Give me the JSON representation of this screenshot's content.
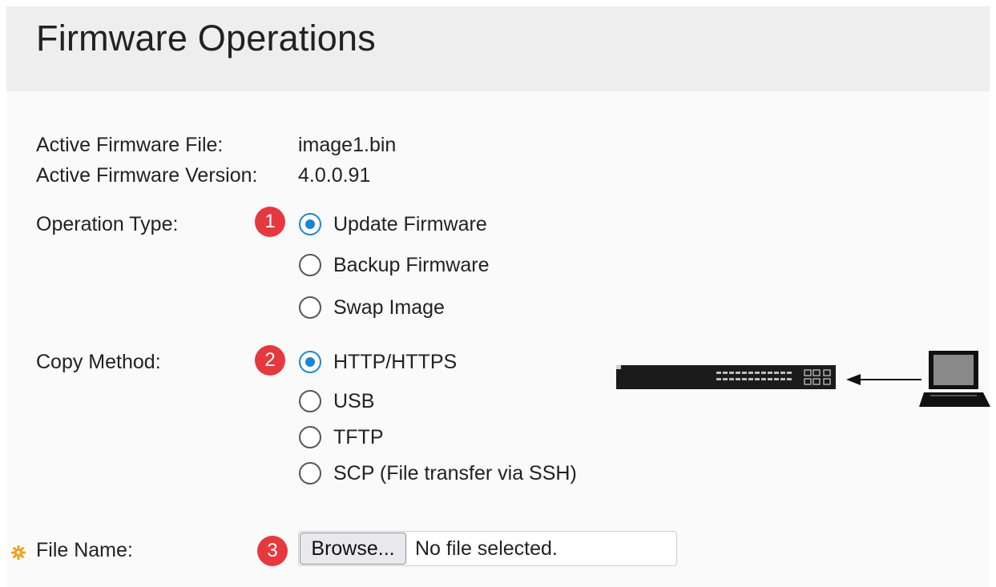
{
  "page": {
    "title": "Firmware Operations"
  },
  "info": {
    "active_file_label": "Active Firmware File:",
    "active_file_value": "image1.bin",
    "active_version_label": "Active Firmware Version:",
    "active_version_value": "4.0.0.91"
  },
  "operation_type": {
    "label": "Operation Type:",
    "step_badge": "1",
    "options": [
      {
        "label": "Update Firmware",
        "checked": true
      },
      {
        "label": "Backup Firmware",
        "checked": false
      },
      {
        "label": "Swap Image",
        "checked": false
      }
    ]
  },
  "copy_method": {
    "label": "Copy Method:",
    "step_badge": "2",
    "options": [
      {
        "label": "HTTP/HTTPS",
        "checked": true
      },
      {
        "label": "USB",
        "checked": false
      },
      {
        "label": "TFTP",
        "checked": false
      },
      {
        "label": "SCP (File transfer via SSH)",
        "checked": false
      }
    ]
  },
  "file_name": {
    "label": "File Name:",
    "step_badge": "3",
    "browse_label": "Browse...",
    "status": "No file selected."
  },
  "icons": {
    "required": "required-star-icon",
    "switch": "network-switch-icon",
    "arrow": "arrow-left-icon",
    "laptop": "laptop-icon"
  },
  "colors": {
    "accent": "#1a86d0",
    "badge": "#e5393f",
    "header_bg": "#eeeeee",
    "required_icon": "#f0a020"
  }
}
